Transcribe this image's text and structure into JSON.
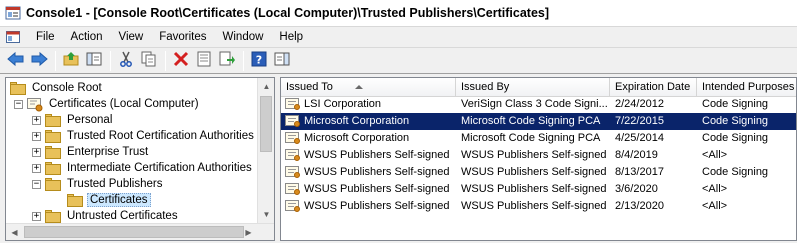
{
  "window": {
    "title": "Console1 - [Console Root\\Certificates (Local Computer)\\Trusted Publishers\\Certificates]"
  },
  "menu": [
    "File",
    "Action",
    "View",
    "Favorites",
    "Window",
    "Help"
  ],
  "toolbar": {
    "buttons": [
      "back-icon",
      "forward-icon",
      "up-folder-icon",
      "show-hide-tree-icon",
      "cut-icon",
      "copy-icon",
      "delete-icon",
      "properties-icon",
      "export-icon",
      "help-icon",
      "view-icon"
    ]
  },
  "tree": {
    "items": [
      {
        "label": "Console Root",
        "expander": ""
      },
      {
        "label": "Certificates (Local Computer)",
        "expander": "−"
      },
      {
        "label": "Personal",
        "expander": "+"
      },
      {
        "label": "Trusted Root Certification Authorities",
        "expander": "+"
      },
      {
        "label": "Enterprise Trust",
        "expander": "+"
      },
      {
        "label": "Intermediate Certification Authorities",
        "expander": "+"
      },
      {
        "label": "Trusted Publishers",
        "expander": "−"
      },
      {
        "label": "Certificates",
        "expander": ""
      },
      {
        "label": "Untrusted Certificates",
        "expander": "+"
      }
    ]
  },
  "list": {
    "columns": [
      "Issued To",
      "Issued By",
      "Expiration Date",
      "Intended Purposes"
    ],
    "rows": [
      [
        "LSI Corporation",
        "VeriSign Class 3 Code Signi...",
        "2/24/2012",
        "Code Signing"
      ],
      [
        "Microsoft Corporation",
        "Microsoft Code Signing PCA",
        "7/22/2015",
        "Code Signing"
      ],
      [
        "Microsoft Corporation",
        "Microsoft Code Signing PCA",
        "4/25/2014",
        "Code Signing"
      ],
      [
        "WSUS Publishers Self-signed",
        "WSUS Publishers Self-signed",
        "8/4/2019",
        "<All>"
      ],
      [
        "WSUS Publishers Self-signed",
        "WSUS Publishers Self-signed",
        "8/13/2017",
        "Code Signing"
      ],
      [
        "WSUS Publishers Self-signed",
        "WSUS Publishers Self-signed",
        "3/6/2020",
        "<All>"
      ],
      [
        "WSUS Publishers Self-signed",
        "WSUS Publishers Self-signed",
        "2/13/2020",
        "<All>"
      ]
    ],
    "selected_row": 1
  },
  "colors": {
    "selection": "#0a246a",
    "tree_selection": "#cce8ff"
  }
}
